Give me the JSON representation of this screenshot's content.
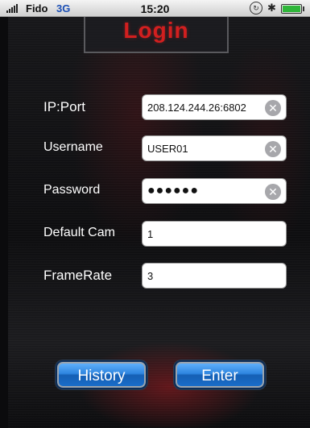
{
  "status_bar": {
    "carrier": "Fido",
    "network": "3G",
    "time": "15:20",
    "icons": [
      "signal-icon",
      "rotation-lock-icon",
      "bluetooth-icon",
      "battery-icon"
    ]
  },
  "header": {
    "title": "Login"
  },
  "form": {
    "ip_port": {
      "label": "IP:Port",
      "value": "208.124.244.26:6802"
    },
    "username": {
      "label": "Username",
      "value": "USER01"
    },
    "password": {
      "label": "Password",
      "value": "●●●●●●"
    },
    "default_cam": {
      "label": "Default Cam",
      "value": "1"
    },
    "frame_rate": {
      "label": "FrameRate",
      "value": "3"
    }
  },
  "buttons": {
    "history": "History",
    "enter": "Enter"
  },
  "colors": {
    "title": "#d21f1f",
    "button": "#2f86e0",
    "background": "#0e0e10"
  }
}
